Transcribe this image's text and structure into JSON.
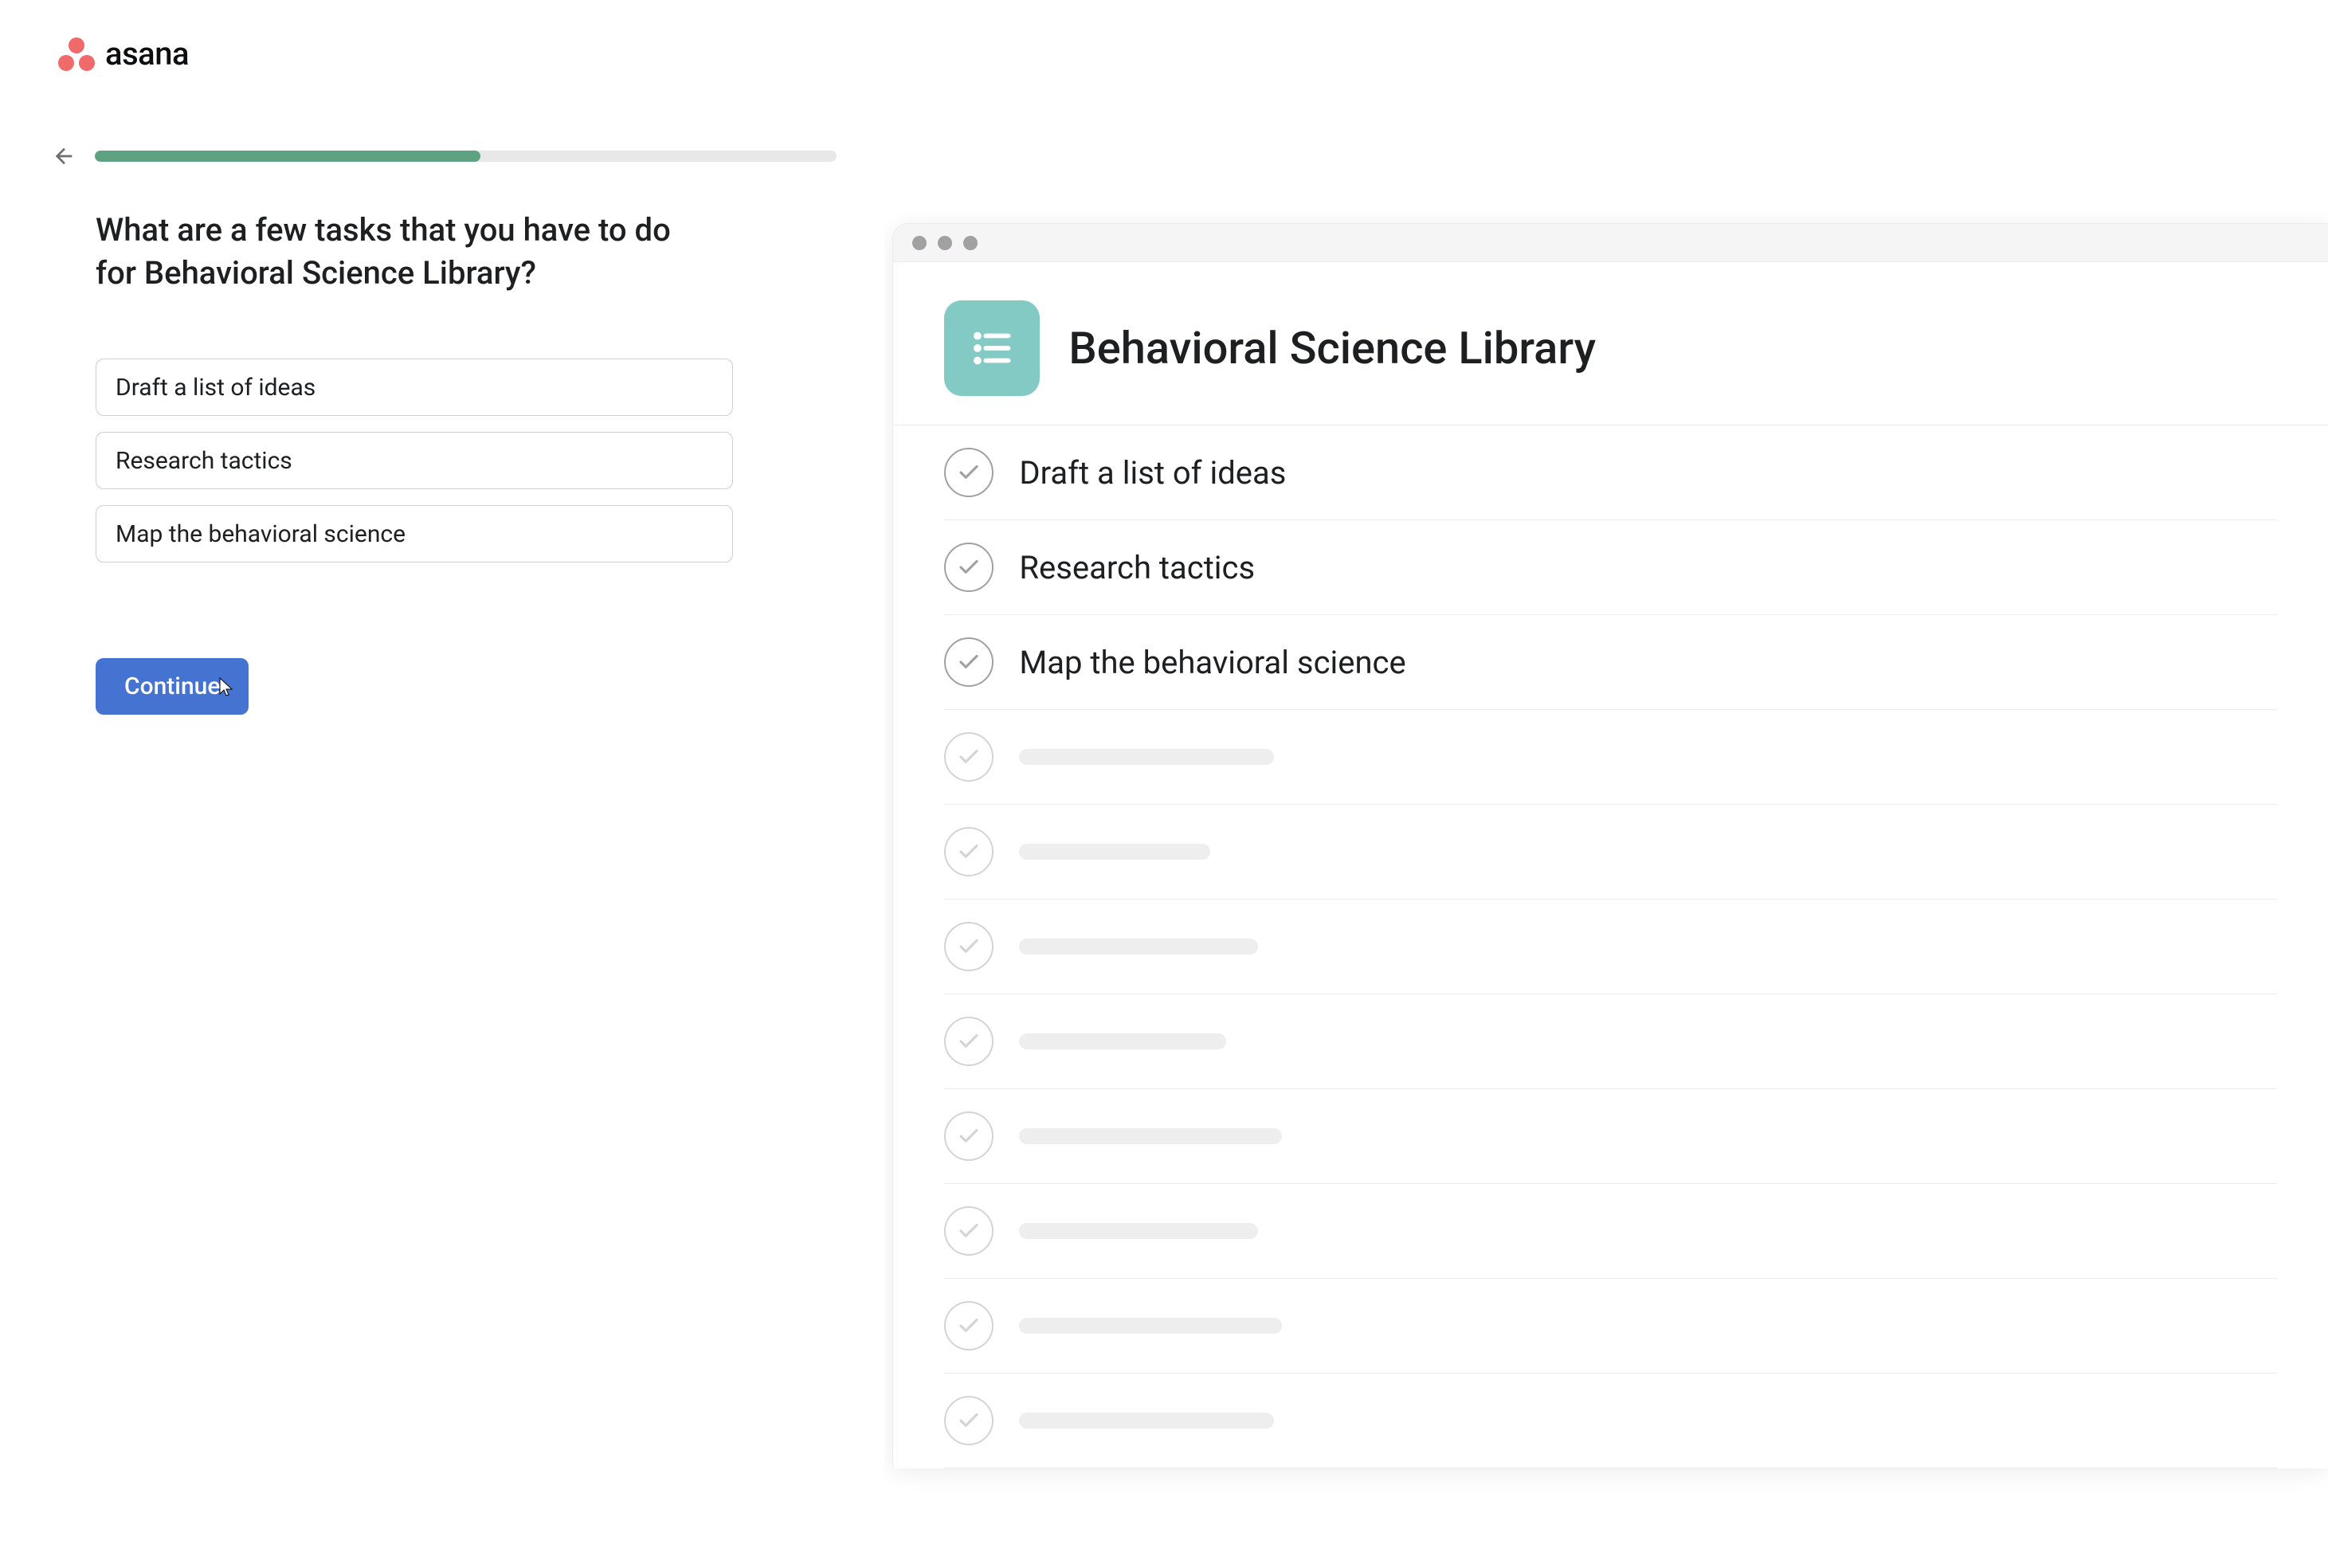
{
  "brand": {
    "name": "asana"
  },
  "onboarding": {
    "question": "What are a few tasks that you have to do for Behavioral Science Library?",
    "progress_percent": 52,
    "tasks": [
      "Draft a list of ideas",
      "Research tactics",
      "Map the behavioral science"
    ],
    "continue_label": "Continue"
  },
  "preview": {
    "project_title": "Behavioral Science Library",
    "tasks": [
      "Draft a list of ideas",
      "Research tactics",
      "Map the behavioral science"
    ],
    "placeholder_count": 8
  },
  "colors": {
    "brand_coral": "#f06a6a",
    "progress_green": "#5da283",
    "button_blue": "#4573d2",
    "project_teal": "#83c9c4"
  }
}
